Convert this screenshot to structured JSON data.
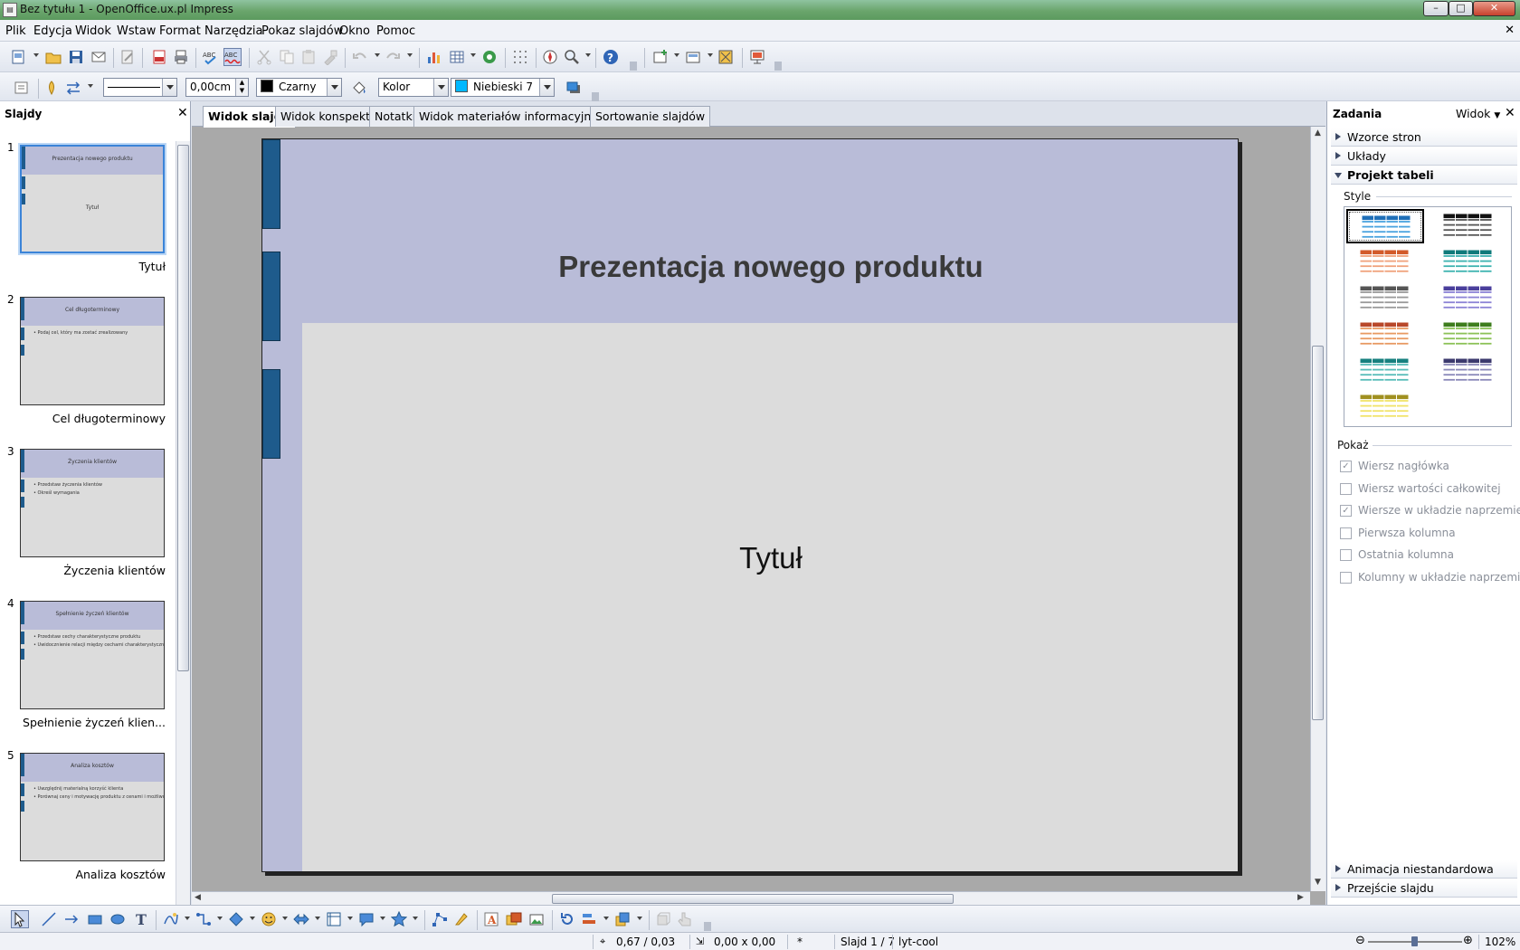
{
  "window": {
    "title": "Bez tytułu 1 - OpenOffice.ux.pl Impress",
    "app_icon": "impress-doc-icon",
    "minimize": "–",
    "maximize": "□",
    "close": "✕"
  },
  "menu": [
    "Plik",
    "Edycja",
    "Widok",
    "Wstaw",
    "Format",
    "Narzędzia",
    "Pokaz slajdów",
    "Okno",
    "Pomoc"
  ],
  "doc_close": "✕",
  "line_props": {
    "width_value": "0,00cm",
    "line_color_label": "Czarny",
    "line_color_hex": "#000000",
    "area_style": "Kolor",
    "area_color_label": "Niebieski 7",
    "area_color_hex": "#00b8ff"
  },
  "slides_panel": {
    "title": "Slajdy",
    "close": "✕",
    "slides": [
      {
        "number": "1",
        "name": "Tytuł",
        "title": "Prezentacja nowego produktu",
        "subtitle": "Tytuł",
        "bullets": []
      },
      {
        "number": "2",
        "name": "Cel długoterminowy",
        "title": "Cel długoterminowy",
        "subtitle": "",
        "bullets": [
          "Podaj cel, który ma zostać zrealizowany"
        ]
      },
      {
        "number": "3",
        "name": "Życzenia klientów",
        "title": "Życzenia klientów",
        "subtitle": "",
        "bullets": [
          "Przedstaw życzenia klientów",
          "Określ wymagania"
        ]
      },
      {
        "number": "4",
        "name": "Spełnienie życzeń klien...",
        "title": "Spełnienie życzeń klientów",
        "subtitle": "",
        "bullets": [
          "Przedstaw cechy charakterystyczne produktu",
          "Uwidocznienie relacji między cechami charakterystycznymi produktu i życzeniami klientów"
        ]
      },
      {
        "number": "5",
        "name": "Analiza kosztów",
        "title": "Analiza kosztów",
        "subtitle": "",
        "bullets": [
          "Uwzględnij materialną korzyść klienta",
          "Porównaj ceny i motywację produktu z cenami i możliwościami produktu konkurencji"
        ]
      }
    ]
  },
  "view_tabs": [
    "Widok slajdu",
    "Widok konspektu",
    "Notatki",
    "Widok materiałów informacyjnych",
    "Sortowanie slajdów"
  ],
  "active_tab": 0,
  "slide": {
    "title": "Prezentacja nowego produktu",
    "subtitle": "Tytuł",
    "header_color": "#b9bcd8",
    "body_color": "#dcdcdc",
    "accent_color": "#1e5b8c"
  },
  "tasks_panel": {
    "title": "Zadania",
    "view_label": "Widok",
    "close": "✕",
    "sections_top": [
      "Wzorce stron",
      "Układy",
      "Projekt tabeli"
    ],
    "style_label": "Style",
    "show_label": "Pokaż",
    "table_styles": [
      {
        "head": "#1f6fb8",
        "body": "#4aa3df"
      },
      {
        "head": "#111111",
        "body": "#555555"
      },
      {
        "head": "#d25a2a",
        "body": "#f0a27c"
      },
      {
        "head": "#0f7a7a",
        "body": "#3db3b0"
      },
      {
        "head": "#555555",
        "body": "#999999"
      },
      {
        "head": "#4a3f9c",
        "body": "#8c83d6"
      },
      {
        "head": "#b8482a",
        "body": "#e89a62"
      },
      {
        "head": "#3e7d1e",
        "body": "#8cc257"
      },
      {
        "head": "#17807f",
        "body": "#57bcb8"
      },
      {
        "head": "#3c3a6e",
        "body": "#8a88b8"
      },
      {
        "head": "#a09020",
        "body": "#f1e36a"
      }
    ],
    "checkboxes": [
      {
        "label": "Wiersz nagłówka",
        "checked": true
      },
      {
        "label": "Wiersz wartości całkowitej",
        "checked": false
      },
      {
        "label": "Wiersze w układzie naprzemienn",
        "checked": true
      },
      {
        "label": "Pierwsza kolumna",
        "checked": false
      },
      {
        "label": "Ostatnia kolumna",
        "checked": false
      },
      {
        "label": "Kolumny w układzie naprzemier",
        "checked": false
      }
    ],
    "sections_bottom": [
      "Animacja niestandardowa",
      "Przejście slajdu"
    ]
  },
  "statusbar": {
    "position": "0,67 / 0,03",
    "size": "0,00 x 0,00",
    "modified": "*",
    "slide_info": "Slajd 1 / 7",
    "layout": "lyt-cool",
    "zoom_minus": "⊖",
    "zoom_plus": "⊕",
    "zoom": "102%"
  }
}
